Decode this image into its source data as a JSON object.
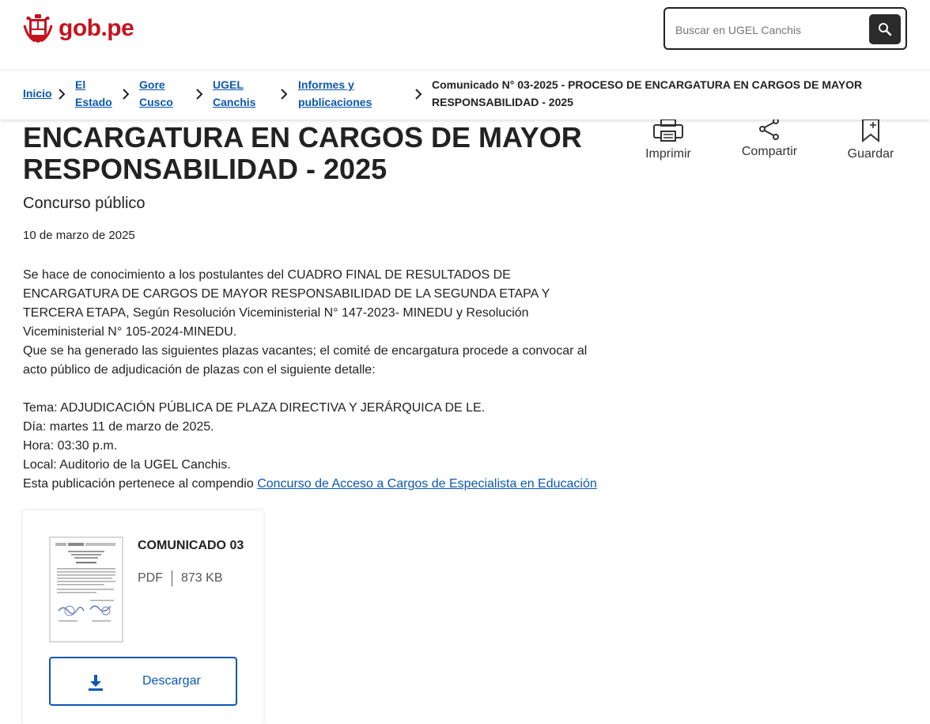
{
  "header": {
    "logo_text": "gob.pe",
    "search_placeholder": "Buscar en UGEL Canchis",
    "search_icon": "search-icon"
  },
  "breadcrumb": {
    "items": [
      {
        "label": "Inicio"
      },
      {
        "label_line1": "El",
        "label_line2": "Estado"
      },
      {
        "label_line1": "Gore",
        "label_line2": "Cusco"
      },
      {
        "label_line1": "UGEL",
        "label_line2": "Canchis"
      },
      {
        "label_line1": "Informes y",
        "label_line2": "publicaciones"
      }
    ],
    "current_line1": "Comunicado N° 03-2025 - PROCESO DE ENCARGATURA EN CARGOS DE MAYOR",
    "current_line2": "RESPONSABILIDAD - 2025"
  },
  "page": {
    "title_line1": "ENCARGATURA EN CARGOS DE MAYOR",
    "title_line2": "RESPONSABILIDAD - 2025",
    "subtitle": "Concurso público",
    "date": "10 de marzo de 2025"
  },
  "actions": {
    "print": "Imprimir",
    "share": "Compartir",
    "save": "Guardar"
  },
  "body": {
    "p1": "Se hace de conocimiento a los postulantes del CUADRO FINAL DE RESULTADOS DE ENCARGATURA DE CARGOS DE MAYOR RESPONSABILIDAD DE LA SEGUNDA ETAPA Y TERCERA ETAPA, Según Resolución Viceministerial N° 147-2023- MINEDU y Resolución Viceministerial N° 105-2024-MINEDU.",
    "p2": "Que se ha generado las siguientes plazas vacantes; el comité de encargatura procede a convocar al acto público de adjudicación de plazas con el siguiente detalle:",
    "tema": "Tema: ADJUDICACIÓN PÚBLICA DE PLAZA DIRECTIVA Y JERÁRQUICA DE LE.",
    "dia": "Día: martes 11 de marzo de 2025.",
    "hora": "Hora: 03:30 p.m.",
    "local": "Local: Auditorio de la UGEL Canchis.",
    "compendio_prefix": "Esta publicación pertenece al compendio ",
    "compendio_link": "Concurso de Acceso a Cargos de Especialista en Educación"
  },
  "document": {
    "title": "COMUNICADO 03",
    "format": "PDF",
    "size": "873 KB",
    "download_label": "Descargar"
  },
  "colors": {
    "brand_red": "#c6121f",
    "link_blue": "#0b58b3",
    "text": "#222222"
  }
}
